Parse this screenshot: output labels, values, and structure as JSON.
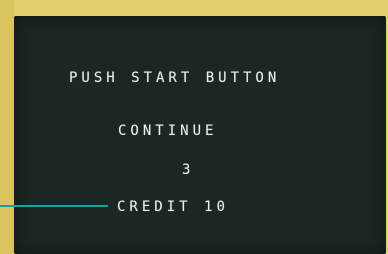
{
  "screen": {
    "title": "PUSH START BUTTON",
    "continue_label": "CONTINUE",
    "continue_count": "3",
    "credit_label": "CREDIT",
    "credit_value": "10"
  },
  "colors": {
    "background": "#e2cf6e",
    "screen": "#1b2724",
    "text": "#e8eee9",
    "callout": "#12a3a0"
  }
}
